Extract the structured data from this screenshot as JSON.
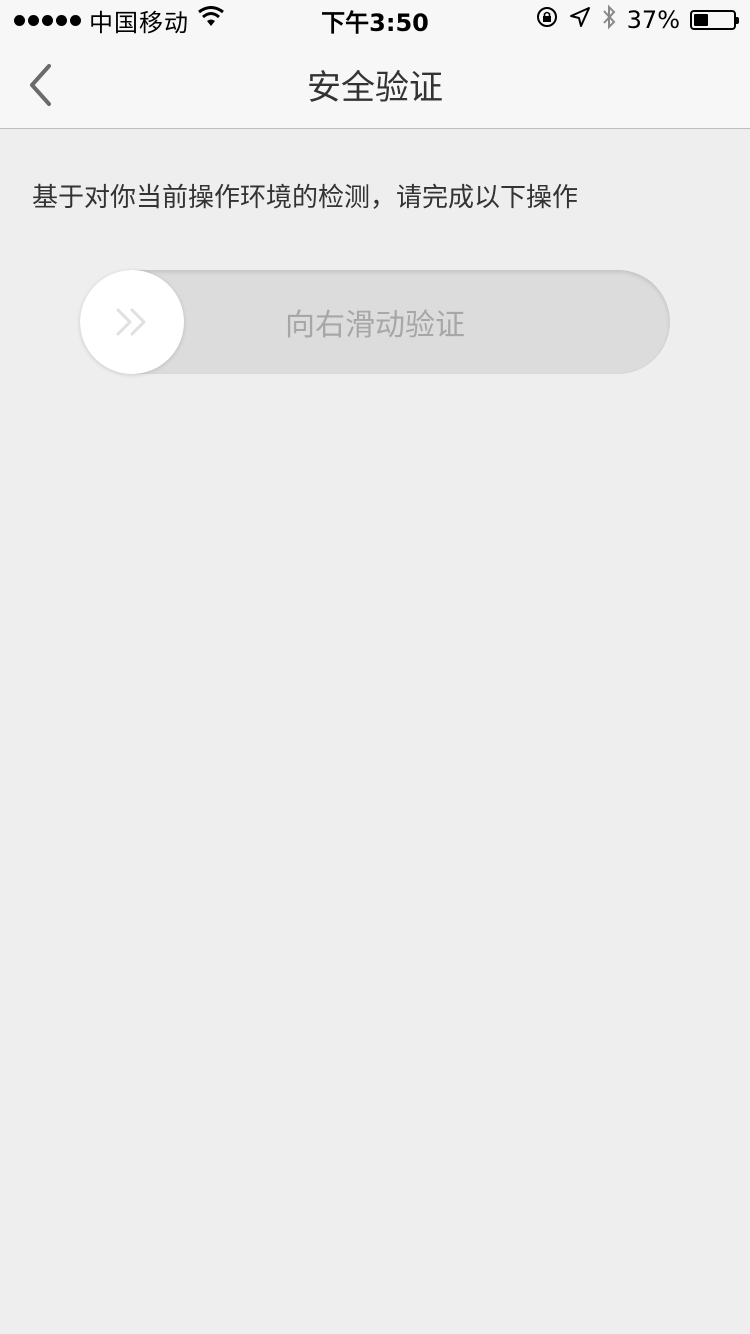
{
  "status_bar": {
    "carrier": "中国移动",
    "time": "下午3:50",
    "battery_percent": "37%",
    "battery_level": 0.37,
    "icons": [
      "signal-dots-icon",
      "wifi-icon",
      "rotation-lock-icon",
      "location-icon",
      "bluetooth-icon",
      "battery-icon"
    ]
  },
  "nav": {
    "title": "安全验证",
    "back_icon": "chevron-left-icon"
  },
  "main": {
    "instruction": "基于对你当前操作环境的检测，请完成以下操作",
    "slider": {
      "label": "向右滑动验证",
      "knob_icon": "double-chevron-right-icon",
      "progress": 0
    }
  },
  "colors": {
    "background": "#eeeeee",
    "nav_background": "#f7f7f7",
    "track": "#dcdcdc",
    "knob": "#ffffff",
    "label": "#a7a7a7"
  }
}
